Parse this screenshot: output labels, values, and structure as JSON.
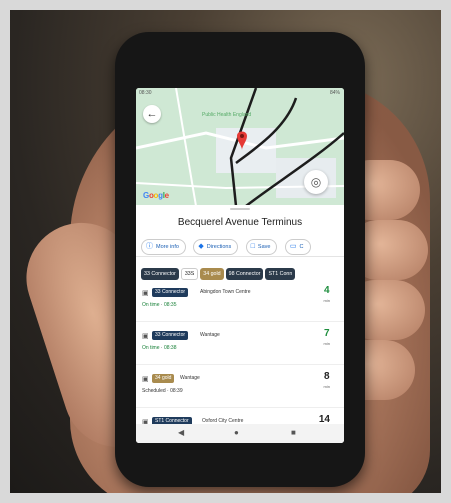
{
  "place": {
    "title": "Becquerel Avenue Terminus",
    "map_label": "Public Health England",
    "google": [
      "G",
      "o",
      "o",
      "g",
      "l",
      "e"
    ]
  },
  "actions": [
    {
      "label": "More info",
      "icon": "info-icon"
    },
    {
      "label": "Directions",
      "icon": "directions-icon"
    },
    {
      "label": "Save",
      "icon": "bookmark-icon"
    },
    {
      "label": "C",
      "icon": "share-icon"
    }
  ],
  "routes": [
    "33 Connector",
    "33S",
    "34 gold",
    "98 Connector",
    "ST1 Conn"
  ],
  "departures": [
    {
      "route": "33 Connector",
      "destination": "Abingdon Town Centre",
      "status": "On time",
      "time": "08:35",
      "minutes": "4",
      "unit": "min",
      "live": true
    },
    {
      "route": "33 Connector",
      "destination": "Wantage",
      "status": "On time",
      "time": "08:38",
      "minutes": "7",
      "unit": "min",
      "live": true
    },
    {
      "route": "34 gold",
      "destination": "Wantage",
      "status": "Scheduled",
      "time": "08:39",
      "minutes": "8",
      "unit": "min",
      "live": false
    },
    {
      "route": "ST1 Connector",
      "destination": "Oxford City Centre",
      "status": "",
      "time": "",
      "minutes": "14",
      "unit": "",
      "live": false
    }
  ],
  "colors": {
    "on_time": "#1e8e3e",
    "route_badge": "#1f3b5c",
    "gold_badge": "#a98b4e",
    "accent": "#1a73e8"
  }
}
